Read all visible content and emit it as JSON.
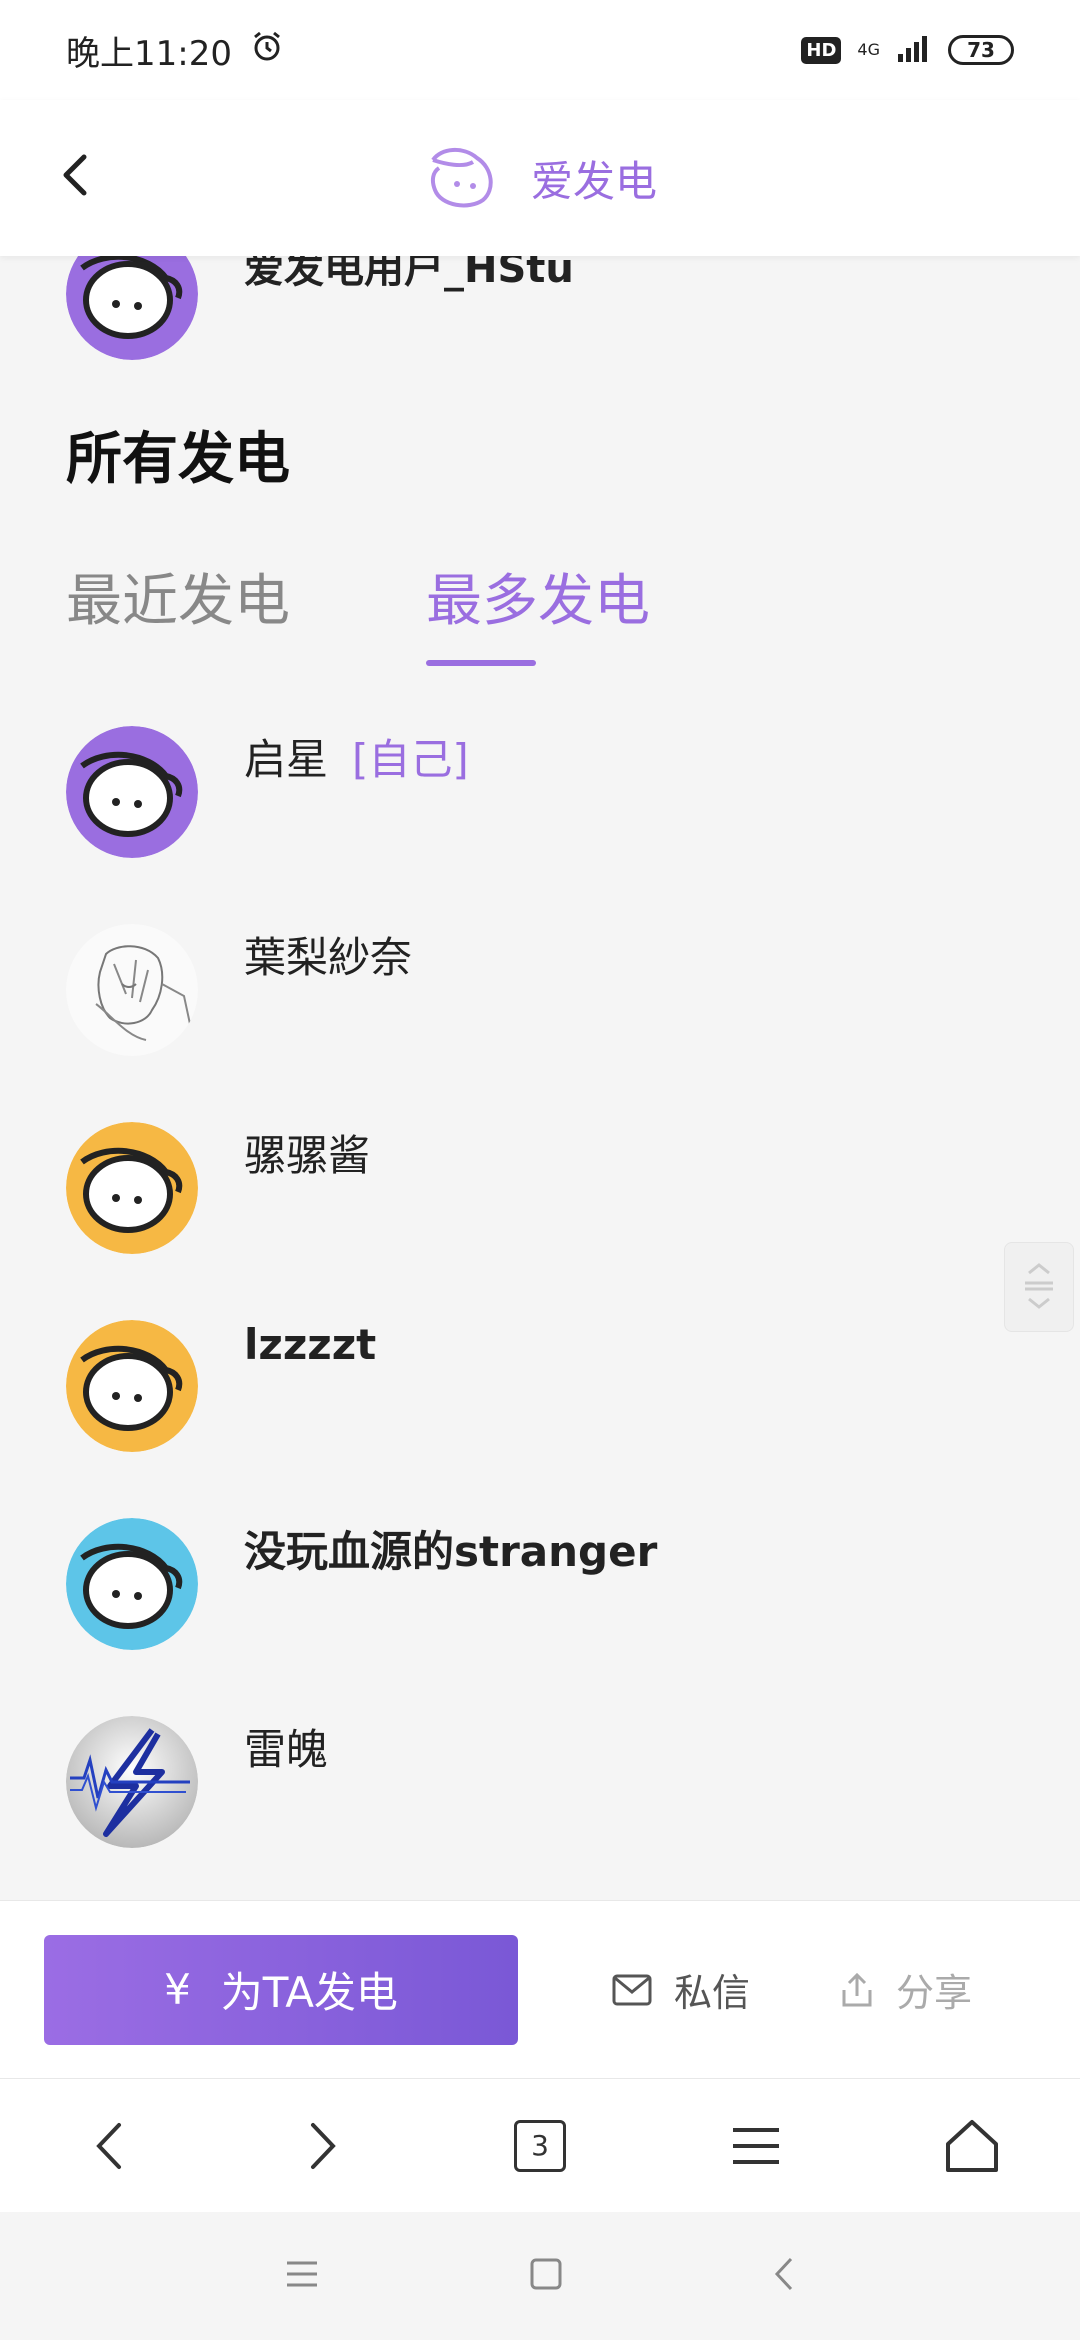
{
  "status_bar": {
    "time": "晚上11:20",
    "hd": "HD",
    "network": "4G",
    "battery": "73"
  },
  "header": {
    "title": "爱发电"
  },
  "partial_user": {
    "name": "爱发电用户_HStu"
  },
  "section_title": "所有发电",
  "tabs": [
    {
      "label": "最近发电",
      "active": false
    },
    {
      "label": "最多发电",
      "active": true
    }
  ],
  "supporters": [
    {
      "name": "启星",
      "tag": "[自己]",
      "avatar": "purple-mascot",
      "color": "#9a6ee0"
    },
    {
      "name": "葉梨紗奈",
      "avatar": "anime-sketch"
    },
    {
      "name": "骡骡酱",
      "avatar": "yellow-mascot",
      "color": "#f6b844"
    },
    {
      "name": "lzzzzt",
      "avatar": "yellow-mascot",
      "color": "#f6b844"
    },
    {
      "name": "没玩血源的stranger",
      "avatar": "blue-mascot",
      "color": "#5dc5e8"
    },
    {
      "name": "雷魄",
      "avatar": "lightning-logo"
    }
  ],
  "actions": {
    "charge_icon": "¥",
    "charge_label": "为TA发电",
    "message_label": "私信",
    "share_label": "分享"
  },
  "browser_bar": {
    "tab_count": "3"
  },
  "colors": {
    "accent": "#9a6ee0",
    "background": "#f5f5f5"
  }
}
